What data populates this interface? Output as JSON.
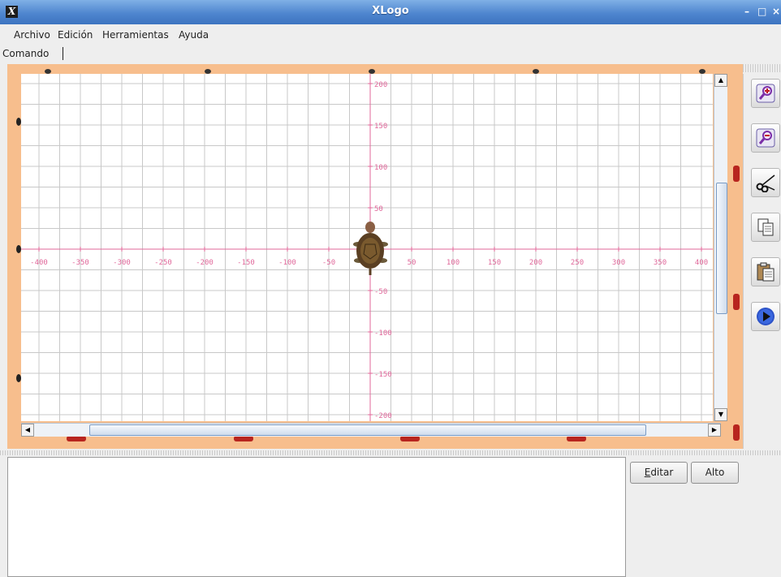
{
  "window": {
    "title": "XLogo",
    "minimize": "–",
    "maximize": "□",
    "close": "×"
  },
  "menu": {
    "items": [
      "Archivo",
      "Edición",
      "Herramientas",
      "Ayuda"
    ]
  },
  "command": {
    "label": "Comando",
    "value": ""
  },
  "canvas": {
    "x_labels": [
      "-400",
      "-350",
      "-300",
      "-250",
      "-200",
      "-150",
      "-100",
      "-50",
      "50",
      "100",
      "150",
      "200",
      "250",
      "300",
      "350",
      "400"
    ],
    "y_labels": [
      "200",
      "150",
      "100",
      "50",
      "-50",
      "-100",
      "-150",
      "-200"
    ],
    "grid_color": "#c8c8c8",
    "axis_color": "#e0679a",
    "border_color": "#f7be8d"
  },
  "buttons": {
    "edit": "Editar",
    "stop": "Alto"
  },
  "tools": [
    "zoom-in-icon",
    "zoom-out-icon",
    "cut-icon",
    "copy-icon",
    "paste-icon",
    "play-icon"
  ]
}
